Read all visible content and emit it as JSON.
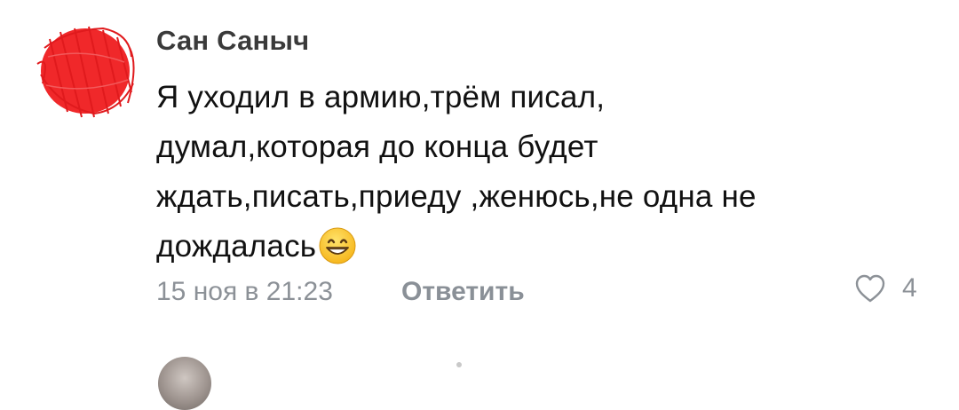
{
  "comment": {
    "author": "Сан Саныч",
    "text_lines": [
      "Я уходил в армию,трём писал,",
      "думал,которая до конца будет",
      "ждать,писать,приеду ,женюсь,не одна не",
      "дождалась"
    ],
    "emoji": "grinning-face-emoji",
    "date": "15 ноя в 21:23",
    "reply_label": "Ответить",
    "like_icon": "heart-outline-icon",
    "like_count": "4"
  },
  "colors": {
    "avatar_scribble": "#f0282a",
    "author": "#3a3a3a",
    "text": "#111111",
    "meta": "#8c9197"
  }
}
